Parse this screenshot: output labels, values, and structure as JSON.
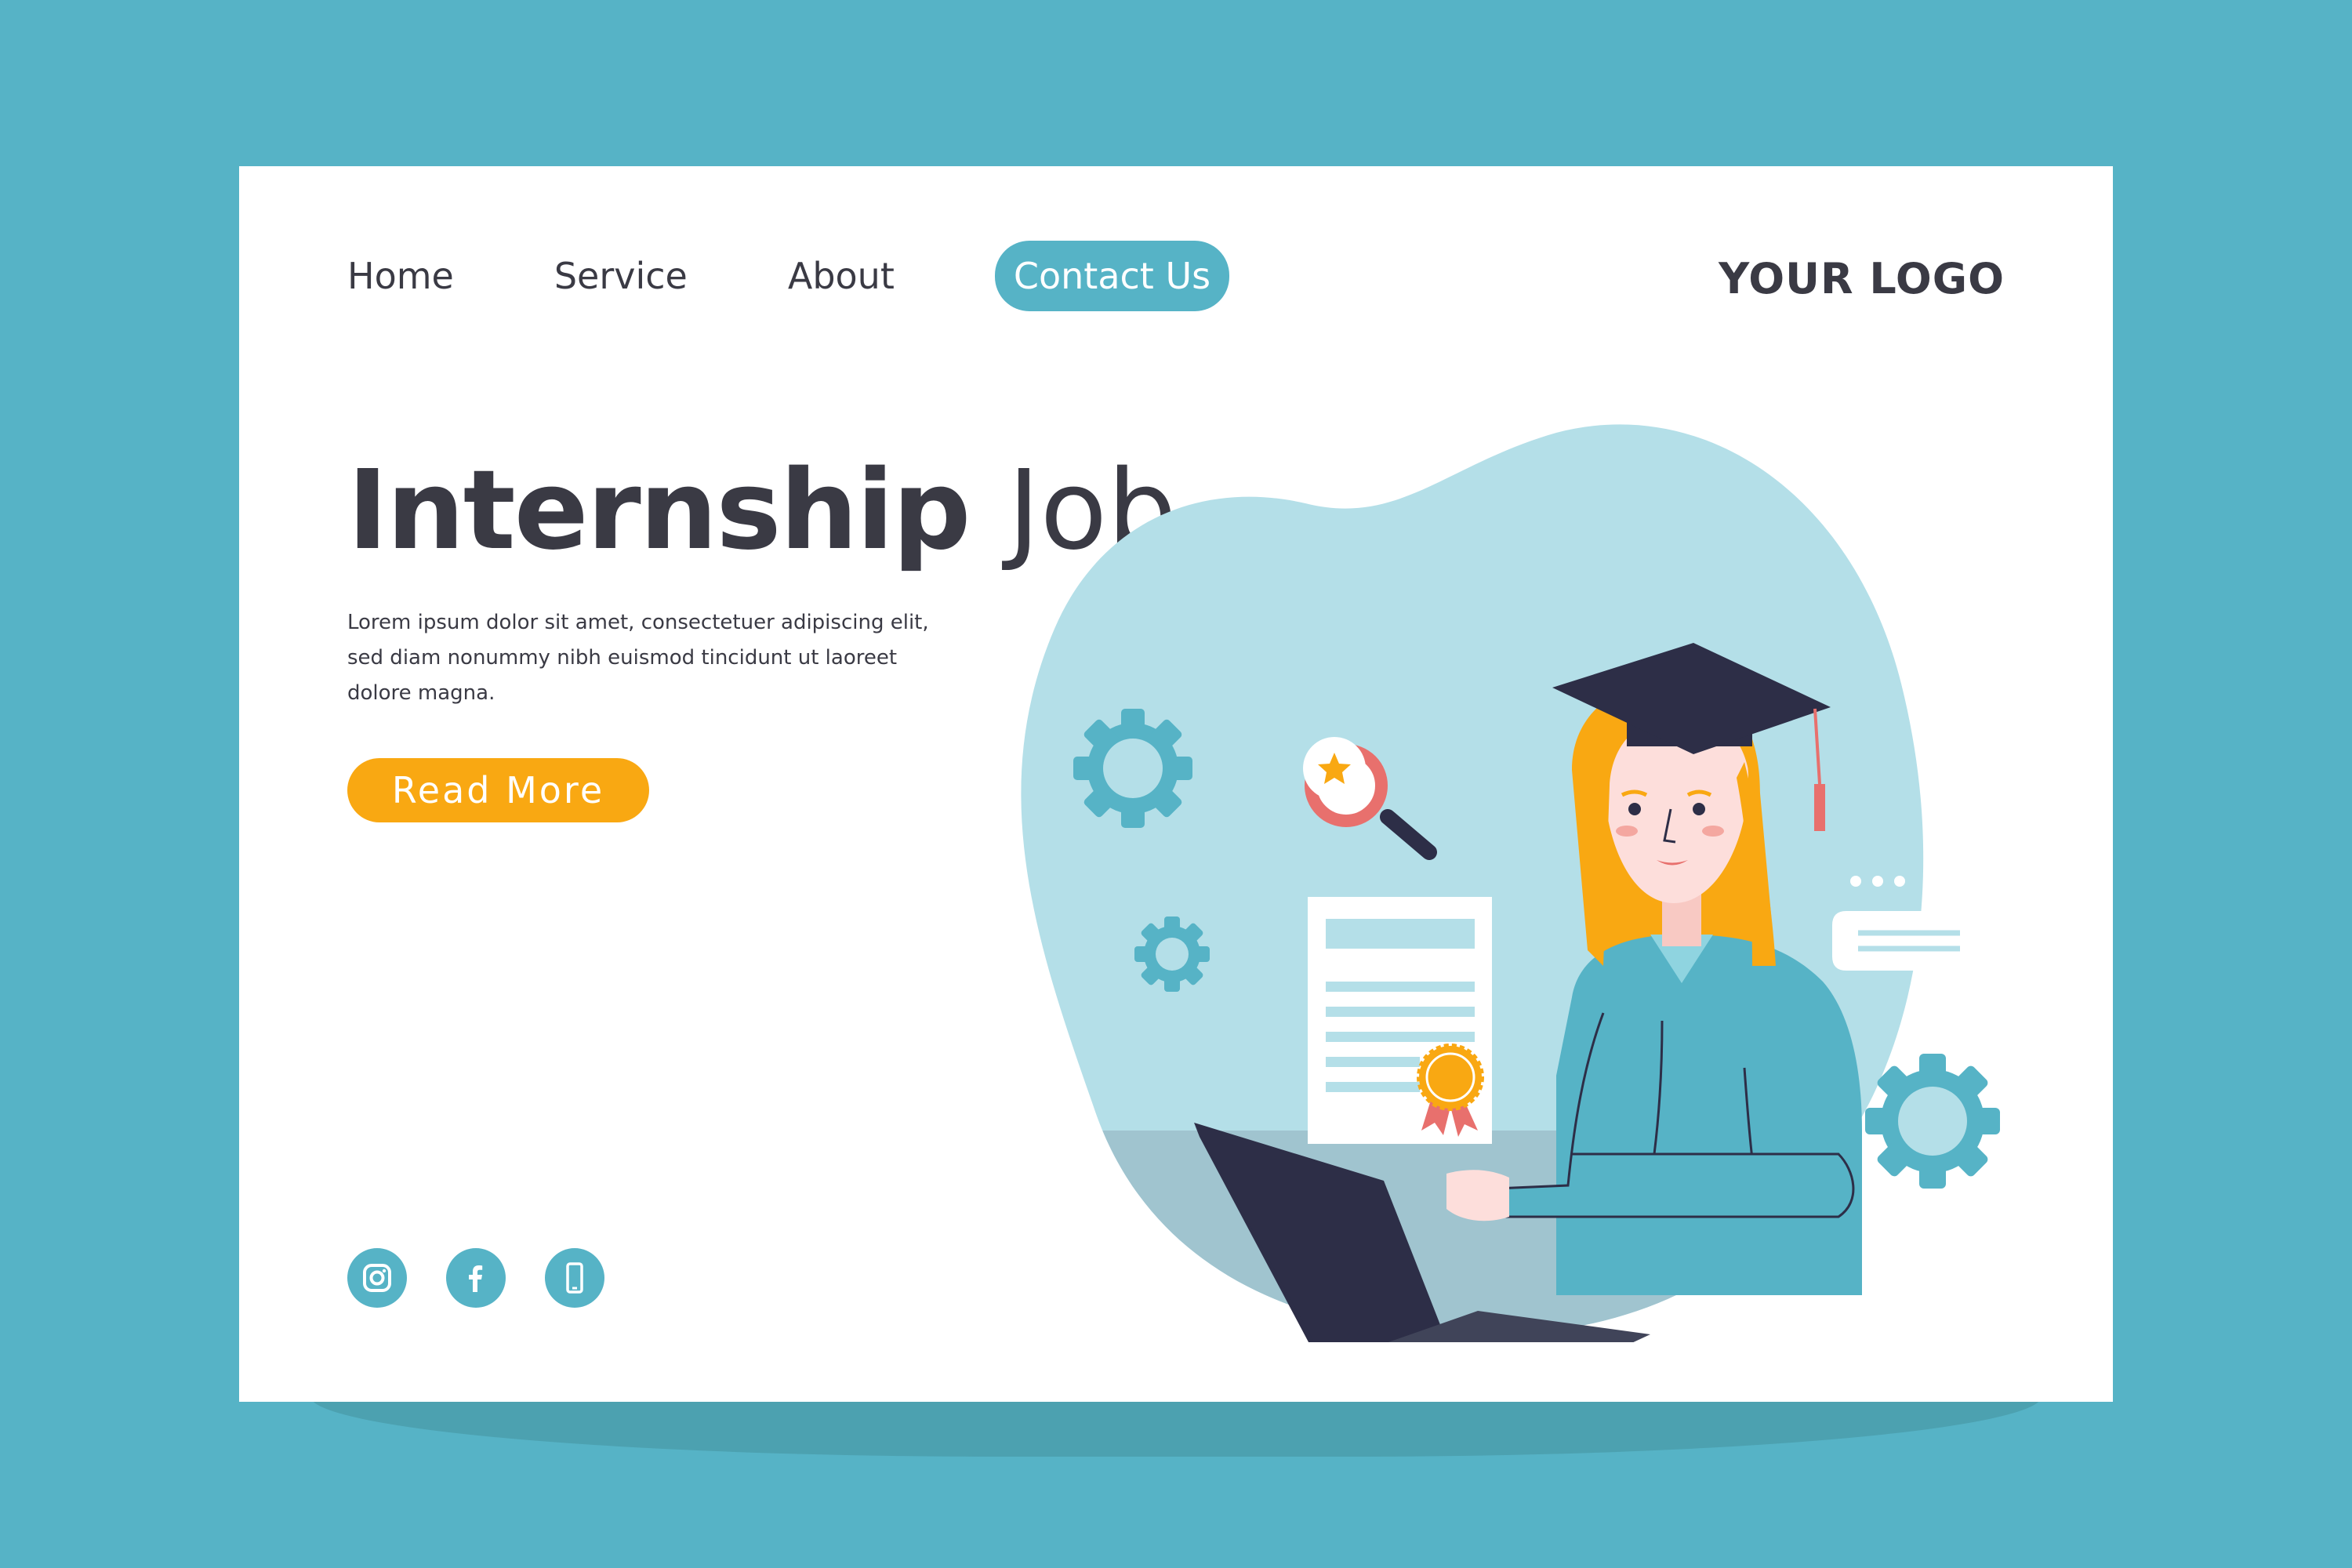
{
  "nav": {
    "items": [
      {
        "label": "Home"
      },
      {
        "label": "Service"
      },
      {
        "label": "About"
      }
    ],
    "cta_label": "Contact Us"
  },
  "logo": {
    "text": "YOUR LOGO"
  },
  "hero": {
    "title_strong": "Internship",
    "title_light": "Job",
    "description": "Lorem ipsum dolor sit amet, consectetuer adipiscing elit, sed diam nonummy nibh euismod tincidunt ut laoreet dolore magna.",
    "button_label": "Read More"
  },
  "socials": [
    {
      "icon": "instagram-icon"
    },
    {
      "icon": "facebook-icon"
    },
    {
      "icon": "phone-icon"
    }
  ],
  "colors": {
    "background": "#56b3c6",
    "accent": "#56b3c6",
    "button": "#f9a812",
    "text": "#3a3a44",
    "blob": "#b4dfe8",
    "desk": "#a0c4cf"
  }
}
